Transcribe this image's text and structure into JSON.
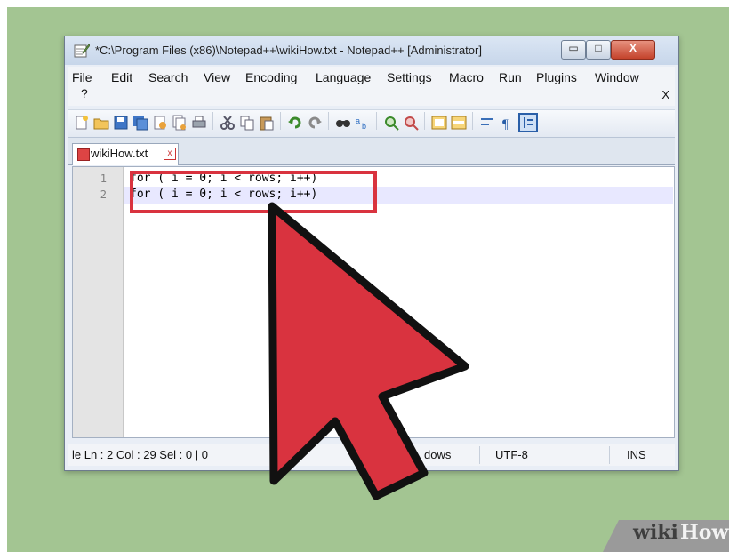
{
  "window": {
    "title": "*C:\\Program Files (x86)\\Notepad++\\wikiHow.txt - Notepad++ [Administrator]",
    "min_label": "▭",
    "max_label": "□",
    "close_label": "X"
  },
  "menu": {
    "items": [
      "File",
      "Edit",
      "Search",
      "View",
      "Encoding",
      "Language",
      "Settings",
      "Macro",
      "Run",
      "Plugins",
      "Window",
      "?"
    ],
    "close_label": "X"
  },
  "tab": {
    "label": "wikiHow.txt",
    "close_label": "x"
  },
  "editor": {
    "lines": [
      {
        "num": "1",
        "text": "for ( i = 0; i < rows; i++)"
      },
      {
        "num": "2",
        "text": "for ( i = 0; i < rows; i++)"
      }
    ]
  },
  "status": {
    "left": "le Ln : 2    Col : 29    Sel : 0 | 0",
    "eol": "dows",
    "encoding": "UTF-8",
    "mode": "INS"
  },
  "colors": {
    "background": "#a3c592",
    "highlight": "#d9333f"
  },
  "watermark": {
    "wiki": "wiki",
    "how": "How"
  }
}
